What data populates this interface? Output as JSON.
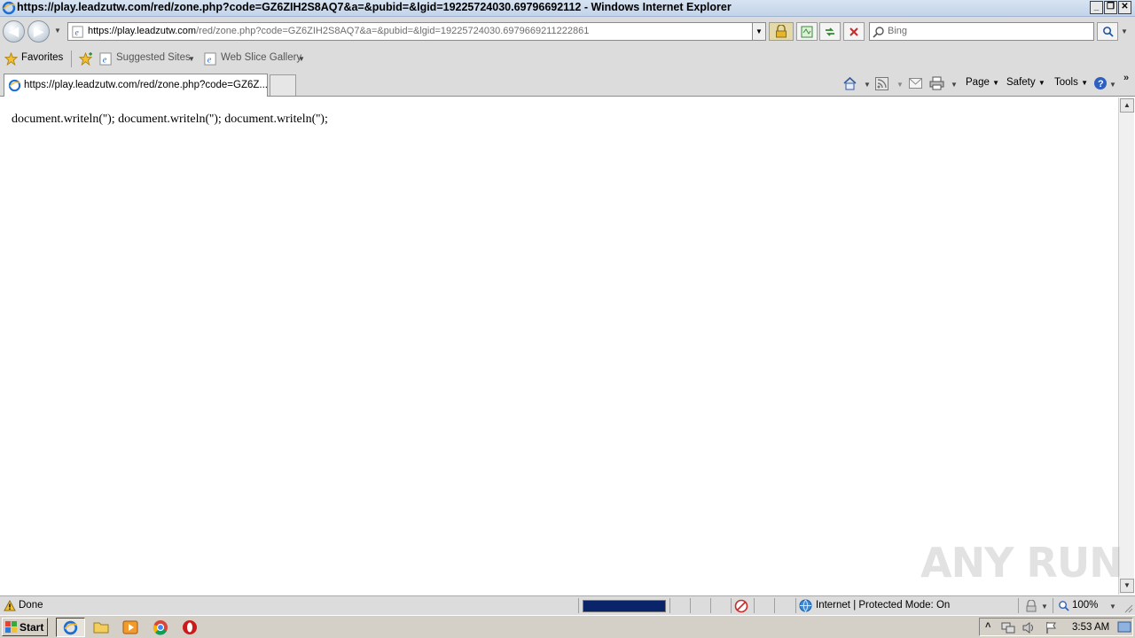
{
  "window": {
    "title": "https://play.leadzutw.com/red/zone.php?code=GZ6ZIH2S8AQ7&a=&pubid=&lgid=19225724030.69796692112 - Windows Internet Explorer"
  },
  "address": {
    "url_host": "https://play.leadzutw.com",
    "url_path": "/red/zone.php?code=GZ6ZIH2S8AQ7&a=&pubid=&lgid=19225724030.6979669211222861"
  },
  "search": {
    "placeholder": "Bing"
  },
  "favorites": {
    "label": "Favorites",
    "items": [
      {
        "label": "Suggested Sites"
      },
      {
        "label": "Web Slice Gallery"
      }
    ]
  },
  "tabs": [
    {
      "label": "https://play.leadzutw.com/red/zone.php?code=GZ6Z..."
    }
  ],
  "command_bar": {
    "page": "Page",
    "safety": "Safety",
    "tools": "Tools"
  },
  "content": {
    "text": "document.writeln(''); document.writeln(''); document.writeln('');"
  },
  "status": {
    "text": "Done",
    "progress": 1.0,
    "zone": "Internet | Protected Mode: On",
    "zoom": "100%"
  },
  "taskbar": {
    "start_label": "Start",
    "clock": "3:53 AM"
  },
  "watermark": "ANY RUN"
}
